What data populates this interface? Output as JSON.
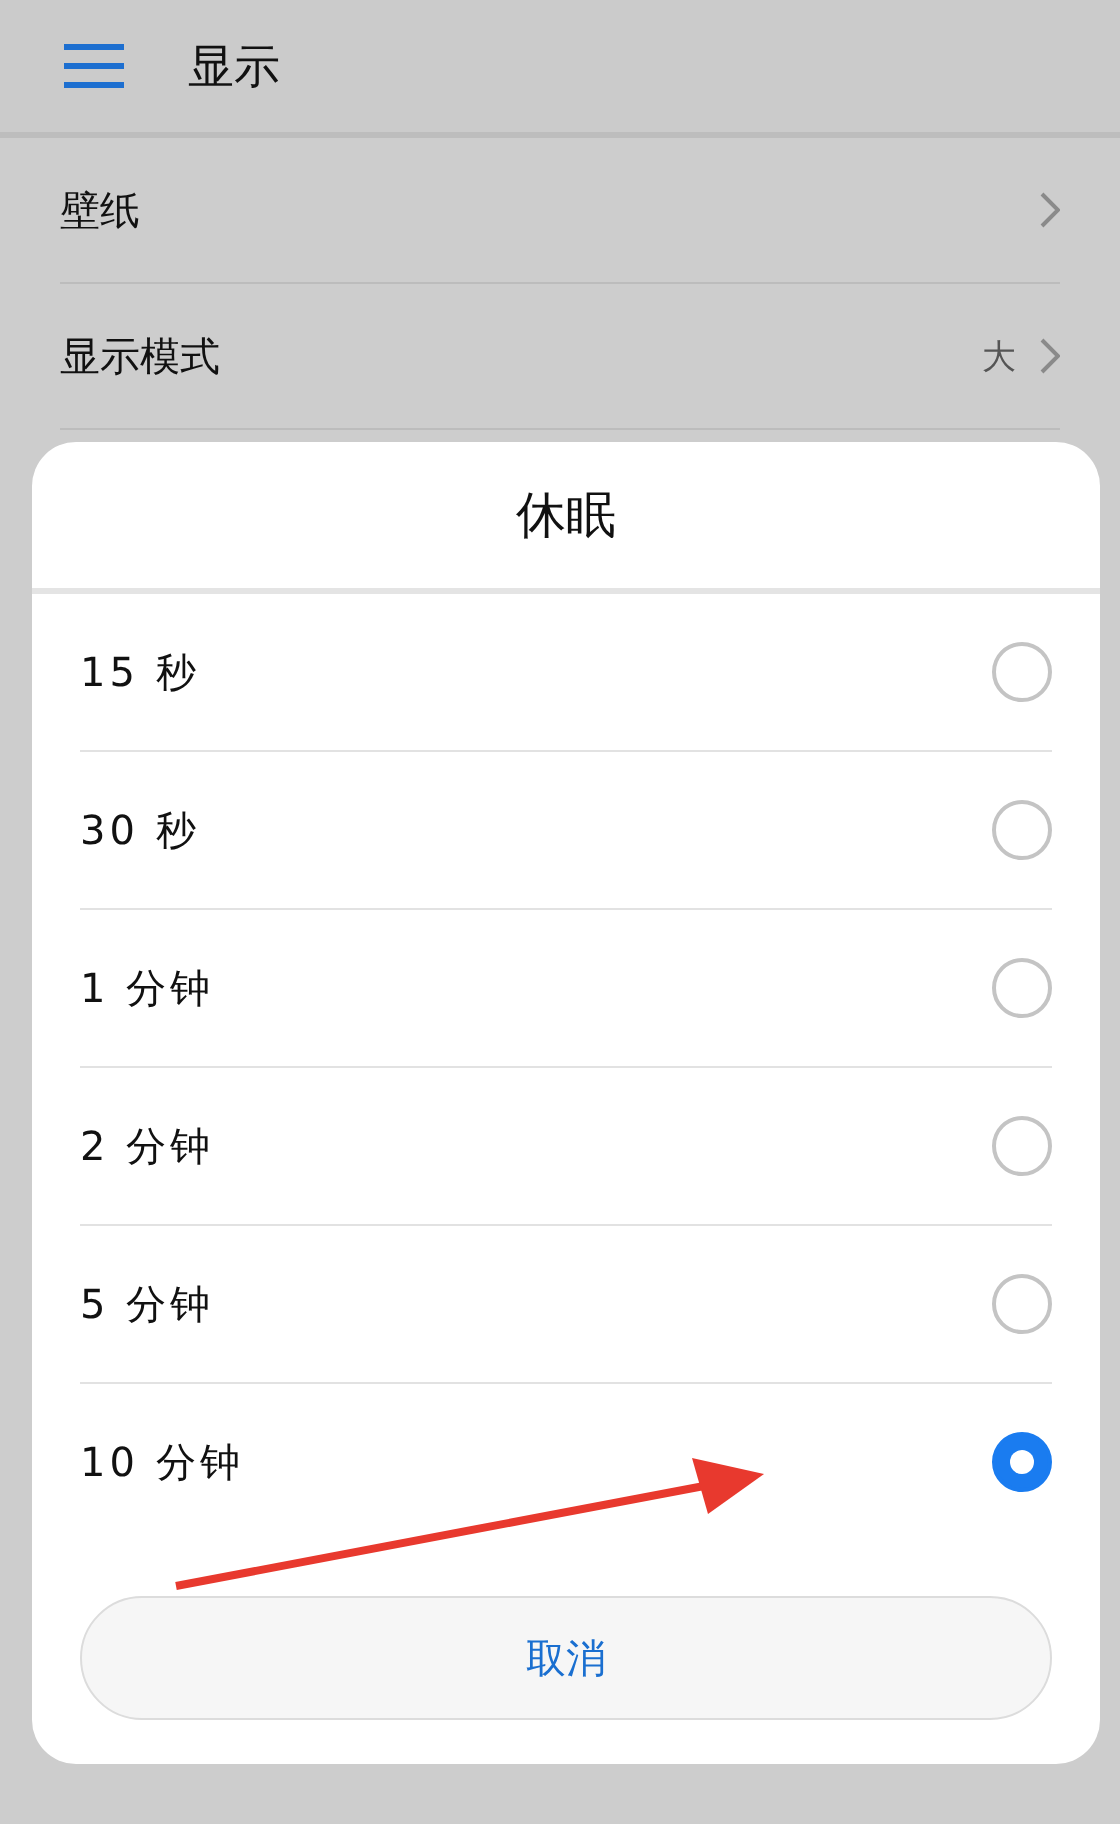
{
  "header": {
    "title": "显示"
  },
  "settings": [
    {
      "label": "壁纸"
    },
    {
      "label": "显示模式",
      "value": "大"
    }
  ],
  "dialog": {
    "title": "休眠",
    "options": [
      {
        "label": "15 秒",
        "selected": false
      },
      {
        "label": "30 秒",
        "selected": false
      },
      {
        "label": "1 分钟",
        "selected": false
      },
      {
        "label": "2 分钟",
        "selected": false
      },
      {
        "label": "5 分钟",
        "selected": false
      },
      {
        "label": "10 分钟",
        "selected": true
      }
    ],
    "cancel": "取消"
  }
}
